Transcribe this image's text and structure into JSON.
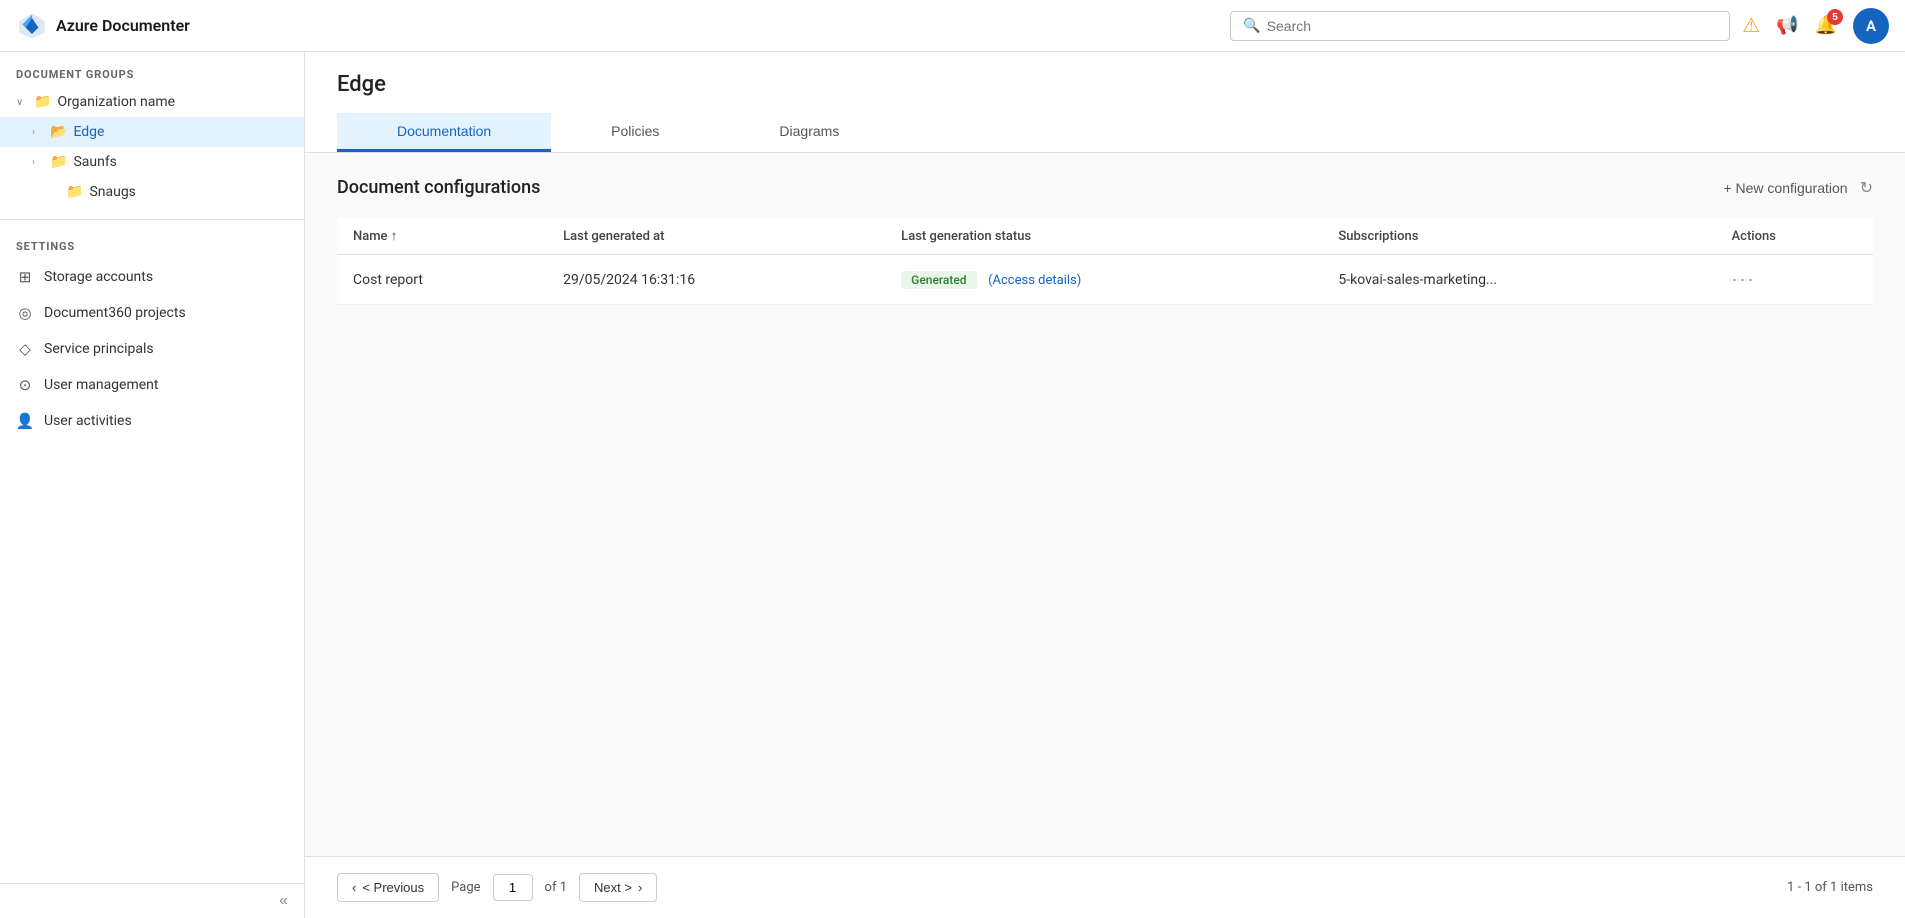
{
  "app": {
    "title": "Azure Documenter",
    "logo_text": "A"
  },
  "header": {
    "search_placeholder": "Search",
    "user_avatar": "A",
    "notification_badge": "5"
  },
  "sidebar": {
    "section_label": "DOCUMENT GROUPS",
    "org_name": "Organization name",
    "items": [
      {
        "id": "edge",
        "label": "Edge",
        "indent": 1,
        "active": true,
        "has_chevron": true
      },
      {
        "id": "saunfs",
        "label": "Saunfs",
        "indent": 1,
        "active": false,
        "has_chevron": true
      },
      {
        "id": "snaugs",
        "label": "Snaugs",
        "indent": 2,
        "active": false,
        "has_chevron": false
      }
    ],
    "settings_label": "SETTINGS",
    "settings_items": [
      {
        "id": "storage-accounts",
        "label": "Storage accounts",
        "icon": "⊞"
      },
      {
        "id": "document360-projects",
        "label": "Document360 projects",
        "icon": "◎"
      },
      {
        "id": "service-principals",
        "label": "Service principals",
        "icon": "◇"
      },
      {
        "id": "user-management",
        "label": "User management",
        "icon": "⊙"
      },
      {
        "id": "user-activities",
        "label": "User activities",
        "icon": "👤"
      }
    ],
    "collapse_icon": "«"
  },
  "content": {
    "page_title": "Edge",
    "tabs": [
      {
        "id": "documentation",
        "label": "Documentation",
        "active": true
      },
      {
        "id": "policies",
        "label": "Policies",
        "active": false
      },
      {
        "id": "diagrams",
        "label": "Diagrams",
        "active": false
      }
    ],
    "doc_configs": {
      "title": "Document configurations",
      "new_config_label": "+ New configuration",
      "refresh_label": "↻",
      "table": {
        "columns": [
          {
            "id": "name",
            "label": "Name ↑"
          },
          {
            "id": "last_generated_at",
            "label": "Last generated at"
          },
          {
            "id": "last_generation_status",
            "label": "Last generation status"
          },
          {
            "id": "subscriptions",
            "label": "Subscriptions"
          },
          {
            "id": "actions",
            "label": "Actions"
          }
        ],
        "rows": [
          {
            "name": "Cost report",
            "last_generated_at": "29/05/2024 16:31:16",
            "status_badge": "Generated",
            "access_details": "(Access details)",
            "subscriptions": "5-kovai-sales-marketing...",
            "actions": "···"
          }
        ]
      }
    },
    "pagination": {
      "previous_label": "< Previous",
      "next_label": "Next >",
      "page_label": "Page",
      "of_label": "of 1",
      "current_page": "1",
      "count_label": "1 - 1 of 1 items"
    }
  }
}
